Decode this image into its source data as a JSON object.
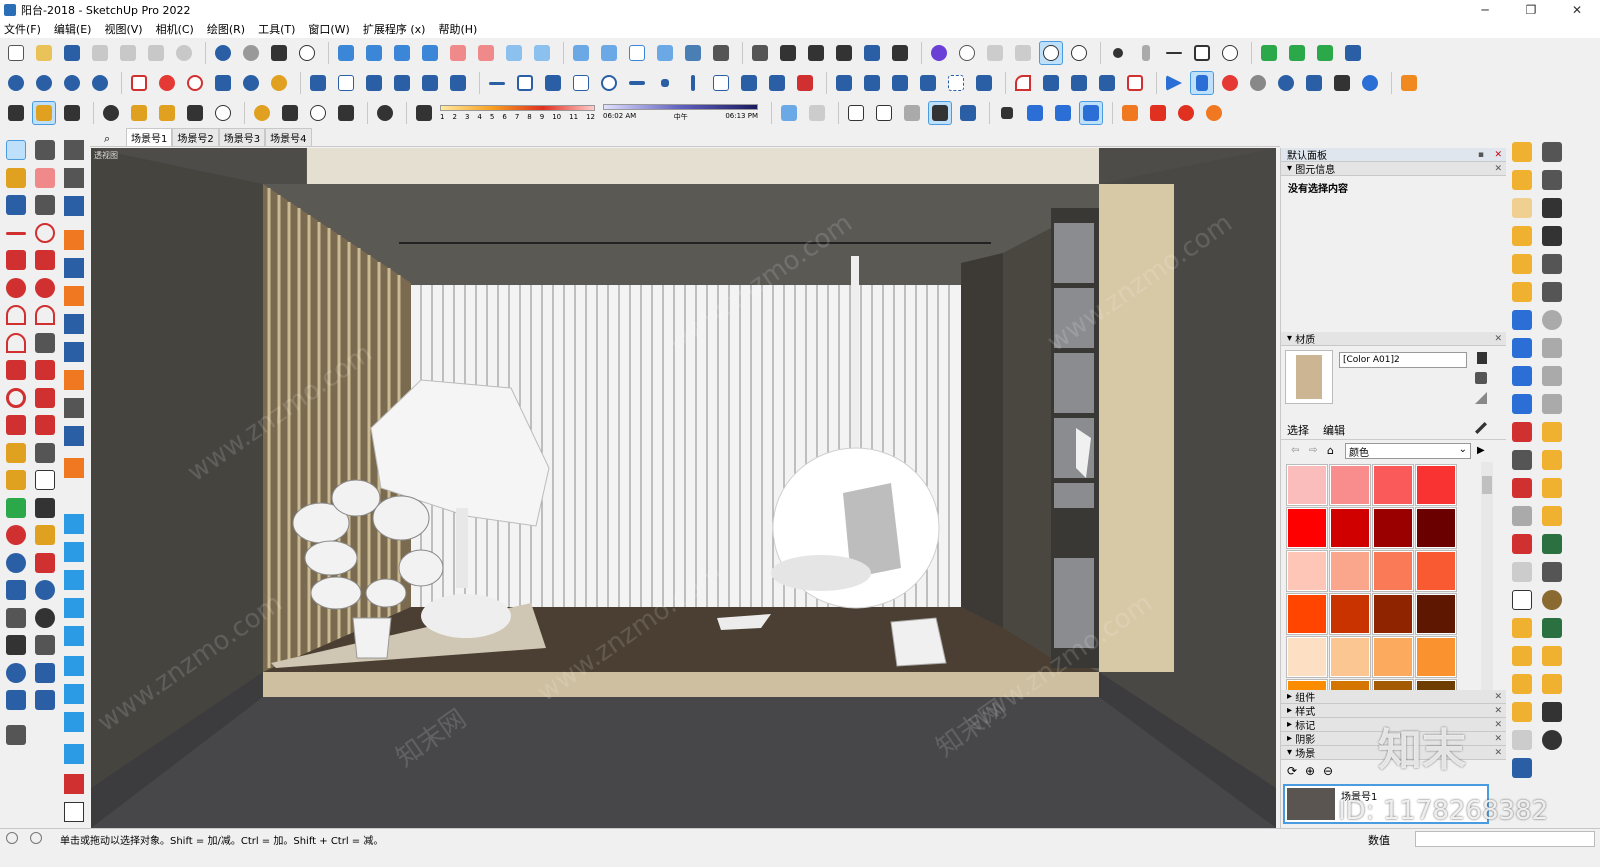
{
  "window": {
    "title": "阳台-2018 - SketchUp Pro 2022",
    "minimize": "─",
    "maximize": "❐",
    "close": "✕"
  },
  "menu": [
    "文件(F)",
    "编辑(E)",
    "视图(V)",
    "相机(C)",
    "绘图(R)",
    "工具(T)",
    "窗口(W)",
    "扩展程序 (x)",
    "帮助(H)"
  ],
  "shadow_ramp": {
    "numbers": [
      "1",
      "2",
      "3",
      "4",
      "5",
      "6",
      "7",
      "8",
      "9",
      "10",
      "11",
      "12"
    ]
  },
  "time_ramp": {
    "start": "06:02 AM",
    "mid": "中午",
    "end": "06:13 PM"
  },
  "scene_tabs": [
    "场景号1",
    "场景号2",
    "场景号3",
    "场景号4"
  ],
  "viewport": {
    "label": "透视图"
  },
  "panel": {
    "tray_title": "默认面板",
    "entity_info": {
      "title": "图元信息",
      "status": "没有选择内容"
    },
    "materials": {
      "title": "材质",
      "material_name": "[Color A01]2",
      "tab_select": "选择",
      "tab_edit": "编辑",
      "category": "颜色",
      "swatch_colors": [
        "#fbbcbc",
        "#f98c8c",
        "#fa5a5a",
        "#f93232",
        "#ff0000",
        "#d10000",
        "#9a0000",
        "#6a0000",
        "#fdc6b6",
        "#f9a68c",
        "#fa7a57",
        "#f95a32",
        "#ff4500",
        "#c93300",
        "#8e2500",
        "#5e1700",
        "#fde0c4",
        "#fbc691",
        "#fcab5e",
        "#fb9230",
        "#fb8c00",
        "#d47500",
        "#a35a00",
        "#6e3d00"
      ]
    },
    "collapsed": [
      "组件",
      "样式",
      "标记",
      "阴影"
    ],
    "scenes": {
      "title": "场景",
      "item_label": "场景号1"
    }
  },
  "status": {
    "message": "单击或拖动以选择对象。Shift = 加/减。Ctrl = 加。Shift + Ctrl = 减。",
    "value_label": "数值"
  },
  "watermark": {
    "site": "www.znzmo.com",
    "brand": "知末网",
    "logo": "知末",
    "id": "ID: 1178268382"
  }
}
